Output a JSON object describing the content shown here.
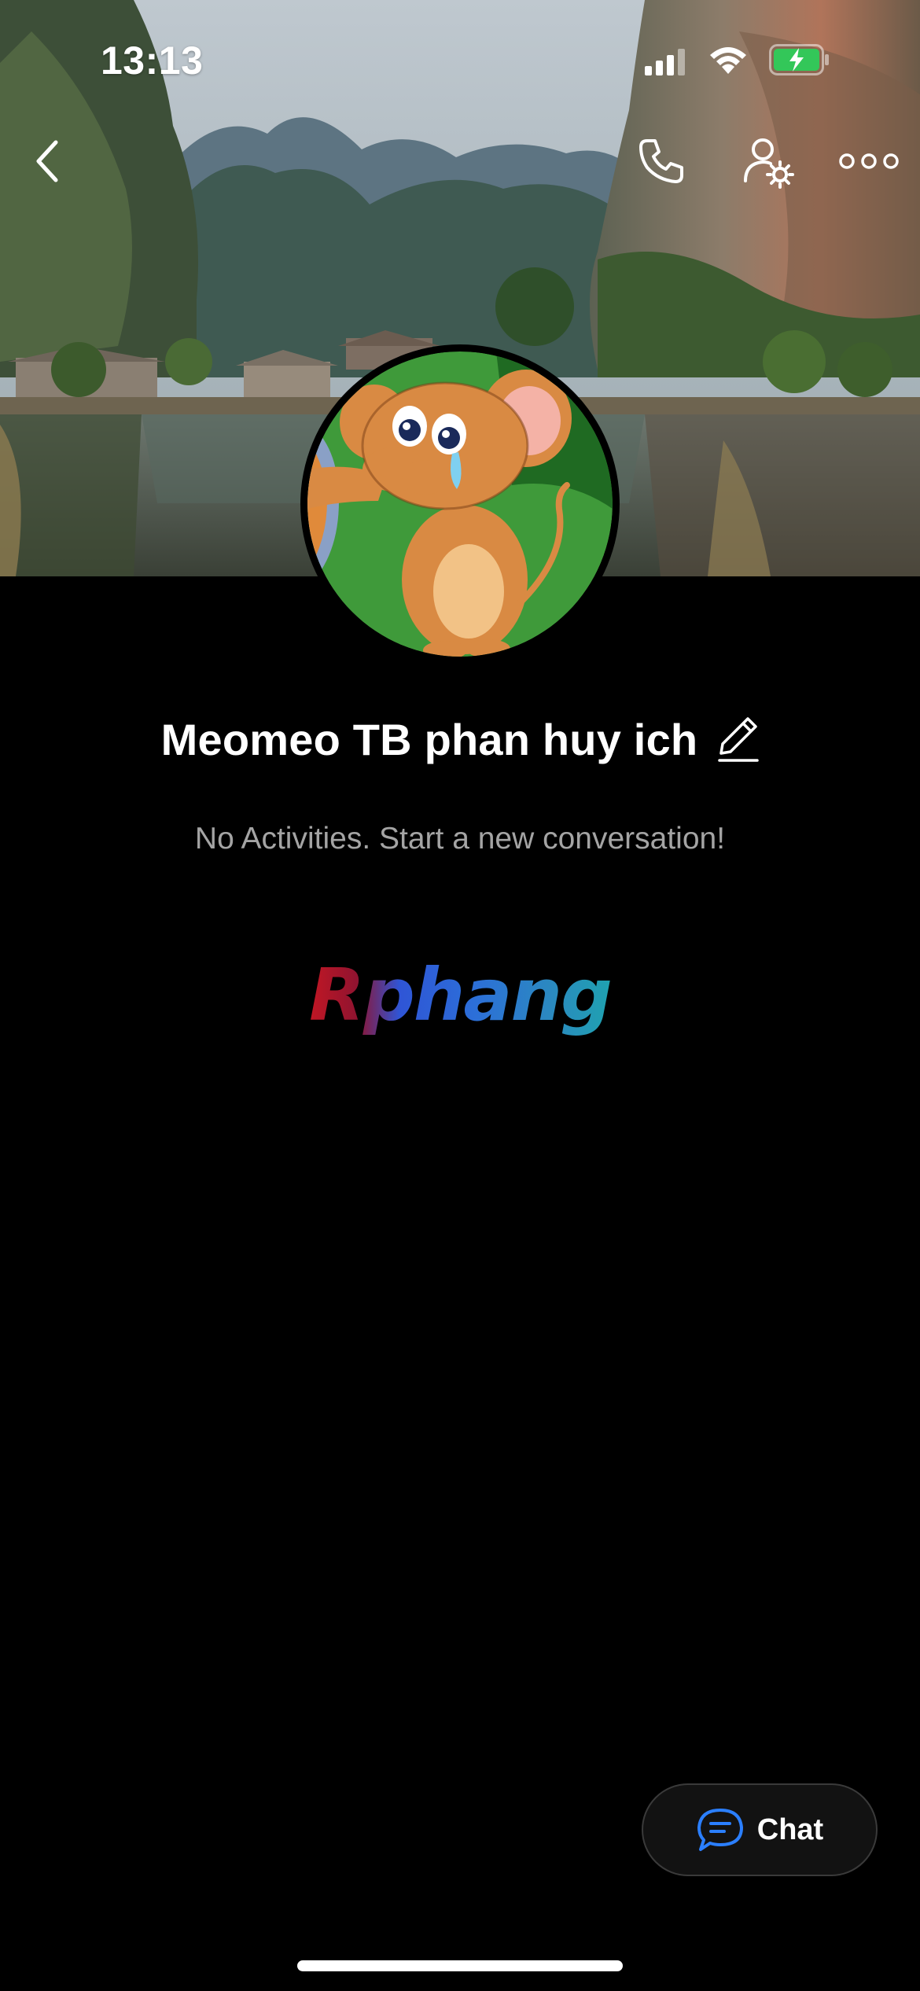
{
  "status_bar": {
    "time": "13:13",
    "signal_icon": "cellular-signal-icon",
    "wifi_icon": "wifi-icon",
    "battery_icon": "battery-charging-icon",
    "battery_color": "#33c759"
  },
  "header": {
    "back_icon": "chevron-left-icon",
    "call_icon": "phone-icon",
    "settings_icon": "user-settings-icon",
    "more_icon": "more-dots-icon"
  },
  "cover": {
    "image": "mountain-lake-village-photo"
  },
  "profile": {
    "avatar_image": "crying-mouse-cartoon",
    "name": "Meomeo TB phan huy ich",
    "edit_icon": "pencil-icon"
  },
  "activity": {
    "empty_message": "No Activities. Start a new conversation!"
  },
  "brand": {
    "logo_text": "Rphang"
  },
  "chat_button": {
    "label": "Chat",
    "icon": "chat-bubble-icon",
    "icon_color": "#2b7fff"
  }
}
